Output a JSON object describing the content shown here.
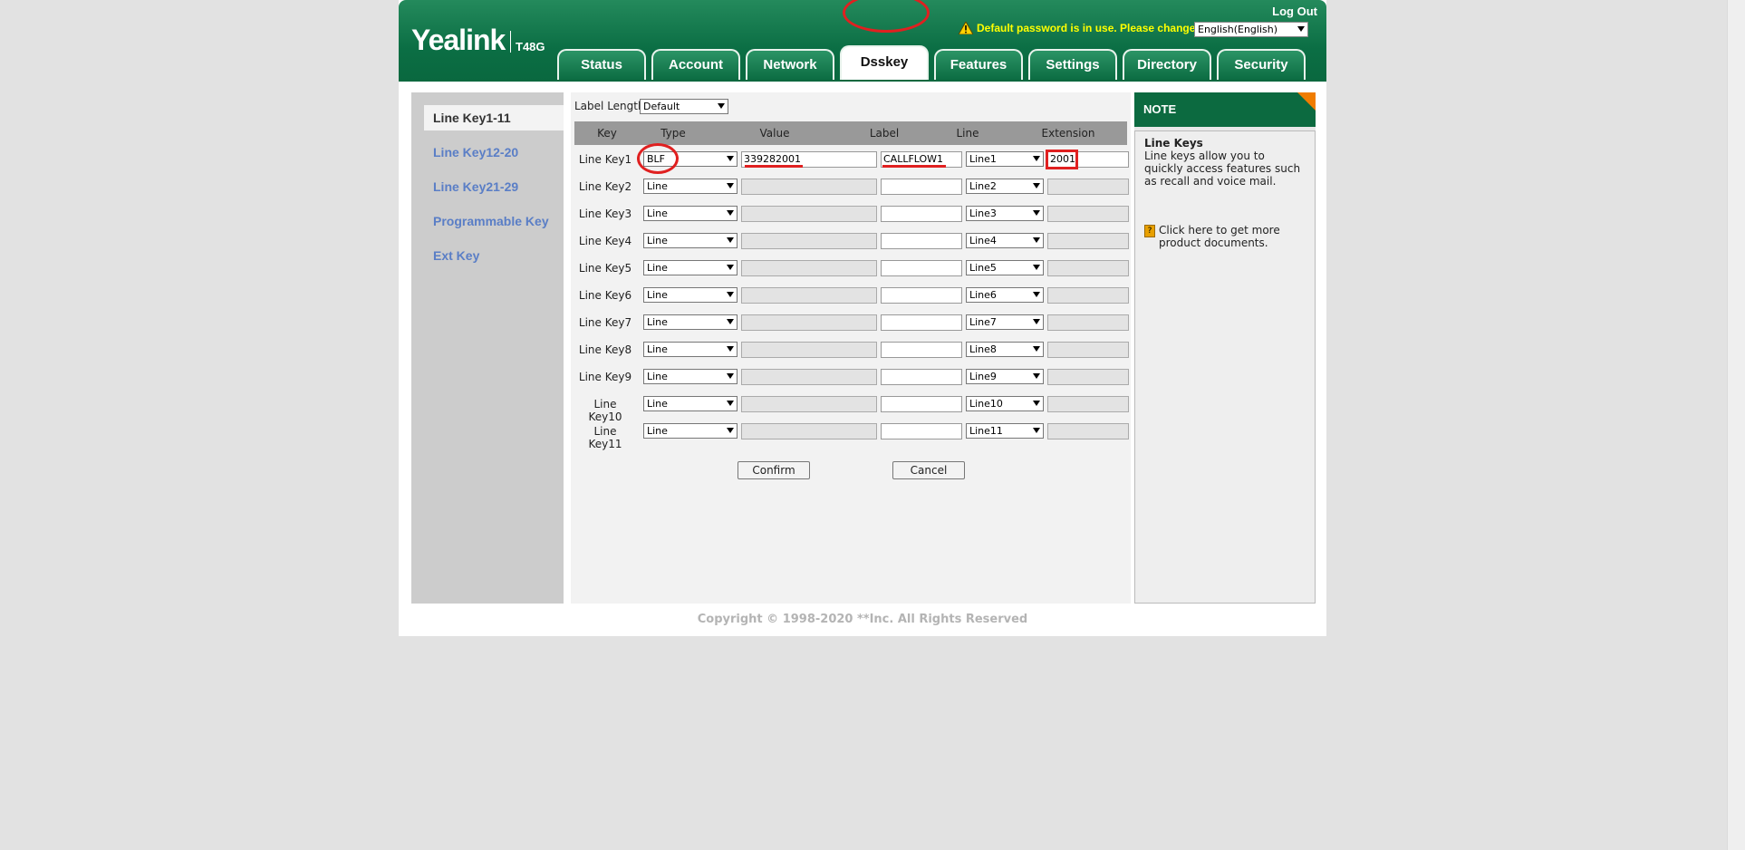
{
  "header": {
    "brand": "Yealink",
    "model": "T48G",
    "logout": "Log Out",
    "warning": "Default password is in use. Please change!",
    "language": "English(English)"
  },
  "tabs": [
    {
      "label": "Status"
    },
    {
      "label": "Account"
    },
    {
      "label": "Network"
    },
    {
      "label": "Dsskey",
      "active": true
    },
    {
      "label": "Features"
    },
    {
      "label": "Settings"
    },
    {
      "label": "Directory"
    },
    {
      "label": "Security"
    }
  ],
  "sidenav": [
    {
      "label": "Line Key1-11",
      "active": true
    },
    {
      "label": "Line Key12-20"
    },
    {
      "label": "Line Key21-29"
    },
    {
      "label": "Programmable Key"
    },
    {
      "label": "Ext Key"
    }
  ],
  "form": {
    "label_length_label": "Label Length",
    "label_length_value": "Default",
    "columns": [
      "Key",
      "Type",
      "Value",
      "Label",
      "Line",
      "Extension"
    ],
    "rows": [
      {
        "key": "Line Key1",
        "type": "BLF",
        "value": "339282001",
        "label": "CALLFLOW1",
        "line": "Line1",
        "extension": "2001"
      },
      {
        "key": "Line Key2",
        "type": "Line",
        "value": "",
        "label": "",
        "line": "Line2",
        "extension": ""
      },
      {
        "key": "Line Key3",
        "type": "Line",
        "value": "",
        "label": "",
        "line": "Line3",
        "extension": ""
      },
      {
        "key": "Line Key4",
        "type": "Line",
        "value": "",
        "label": "",
        "line": "Line4",
        "extension": ""
      },
      {
        "key": "Line Key5",
        "type": "Line",
        "value": "",
        "label": "",
        "line": "Line5",
        "extension": ""
      },
      {
        "key": "Line Key6",
        "type": "Line",
        "value": "",
        "label": "",
        "line": "Line6",
        "extension": ""
      },
      {
        "key": "Line Key7",
        "type": "Line",
        "value": "",
        "label": "",
        "line": "Line7",
        "extension": ""
      },
      {
        "key": "Line Key8",
        "type": "Line",
        "value": "",
        "label": "",
        "line": "Line8",
        "extension": ""
      },
      {
        "key": "Line Key9",
        "type": "Line",
        "value": "",
        "label": "",
        "line": "Line9",
        "extension": ""
      },
      {
        "key": "Line Key10",
        "type": "Line",
        "value": "",
        "label": "",
        "line": "Line10",
        "extension": ""
      },
      {
        "key": "Line Key11",
        "type": "Line",
        "value": "",
        "label": "",
        "line": "Line11",
        "extension": ""
      }
    ],
    "confirm": "Confirm",
    "cancel": "Cancel"
  },
  "note": {
    "heading": "NOTE",
    "title": "Line Keys",
    "text": "Line keys allow you to quickly access features such as recall and voice mail.",
    "link": "Click here to get more product documents."
  },
  "footer": "Copyright © 1998-2020 **Inc. All Rights Reserved",
  "colors": {
    "header_green": "#0b6e44",
    "nav_blue": "#5a7ec6",
    "annotation_red": "#e02020",
    "warning_yellow": "#ffff00"
  }
}
